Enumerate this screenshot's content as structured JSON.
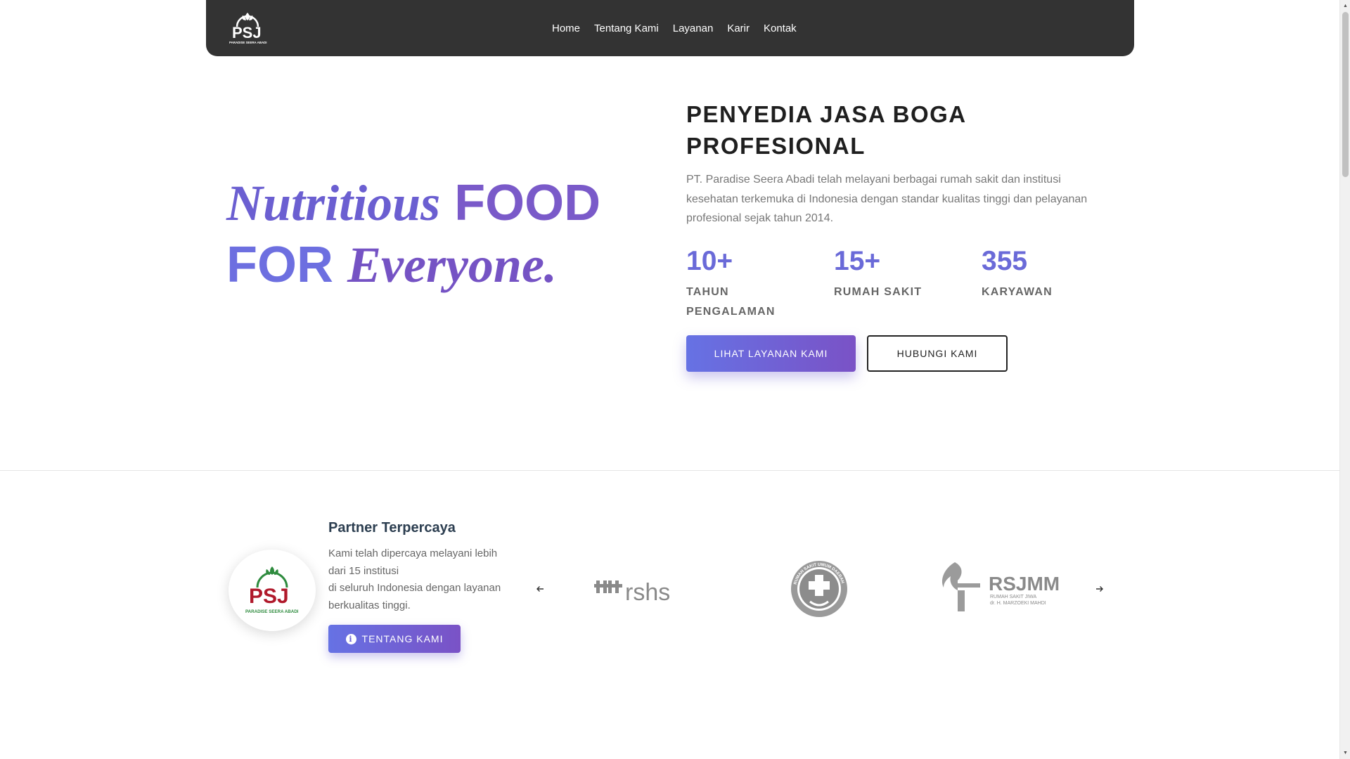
{
  "brand": {
    "logo_text": "PSJ",
    "logo_subtitle": "PARADISE SEERA ABADI",
    "accent_color": "#6a6ad8",
    "accent_color_2": "#7a52c6",
    "nav_background": "#333333"
  },
  "nav": {
    "items": [
      {
        "label": "Home"
      },
      {
        "label": "Tentang Kami"
      },
      {
        "label": "Layanan"
      },
      {
        "label": "Karir"
      },
      {
        "label": "Kontak"
      }
    ]
  },
  "hero": {
    "title_part1": "Nutritious",
    "title_part2": "FOOD",
    "title_part3": "FOR",
    "title_part4": "Everyone.",
    "heading": "PENYEDIA JASA BOGA PROFESIONAL",
    "description": "PT. Paradise Seera Abadi telah melayani berbagai rumah sakit dan institusi kesehatan terkemuka di Indonesia dengan standar kualitas tinggi dan pelayanan profesional sejak tahun 2014.",
    "stats": [
      {
        "value": "10+",
        "label": "TAHUN PENGALAMAN"
      },
      {
        "value": "15+",
        "label": "RUMAH SAKIT"
      },
      {
        "value": "355",
        "label": "KARYAWAN"
      }
    ],
    "primary_button": "LIHAT LAYANAN KAMI",
    "secondary_button": "HUBUNGI KAMI"
  },
  "partners": {
    "title": "Partner Terpercaya",
    "description_line1": "Kami telah dipercaya melayani lebih dari 15 institusi",
    "description_line2": "di seluruh Indonesia dengan layanan berkualitas tinggi.",
    "about_button": "TENTANG KAMI",
    "prev_icon": "arrow-left-icon",
    "next_icon": "arrow-right-icon",
    "logos": [
      {
        "name": "rshs",
        "text": "rshs"
      },
      {
        "name": "rsud",
        "text": "RUMAH SAKIT UMUM DAERAH"
      },
      {
        "name": "rsjmm",
        "text": "RSJMM",
        "subtitle_1": "RUMAH SAKIT JIWA",
        "subtitle_2": "dr. H. MARZOEKI MAHDI"
      }
    ]
  }
}
